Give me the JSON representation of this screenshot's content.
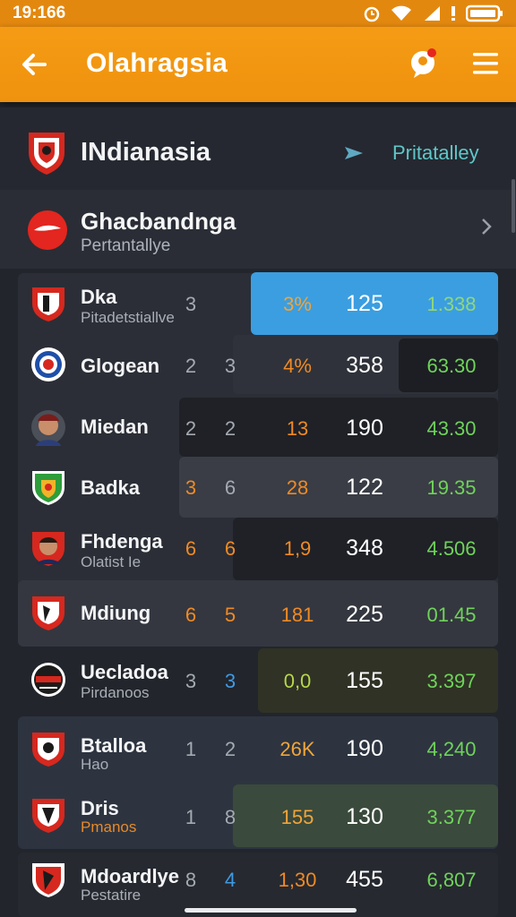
{
  "status_bar": {
    "time": "19:166"
  },
  "app_bar": {
    "title": "Olahragsia"
  },
  "league": {
    "name": "INdianasia",
    "link": "Pritatalley"
  },
  "team": {
    "name": "Ghacbandnga",
    "subtitle": "Pertantallye"
  },
  "colors": {
    "accent": "#f59b14",
    "highlight": "#3b9ee0",
    "value_green": "#6fd35a",
    "value_orange": "#f08a24"
  },
  "rows": [
    {
      "name": "Dka",
      "sub": "Pitadetstiallve",
      "c1": "3",
      "c2": "",
      "c3": "3%",
      "c4": "125",
      "c5": "1.338",
      "logo": "red-shield-icon"
    },
    {
      "name": "Glogean",
      "sub": "",
      "c1": "2",
      "c2": "3",
      "c3": "4%",
      "c4": "358",
      "c5": "63.30",
      "logo": "blue-ring-icon"
    },
    {
      "name": "Miedan",
      "sub": "",
      "c1": "2",
      "c2": "2",
      "c3": "13",
      "c4": "190",
      "c5": "43.30",
      "logo": "player-face-icon"
    },
    {
      "name": "Badka",
      "sub": "",
      "c1": "3",
      "c2": "6",
      "c3": "28",
      "c4": "122",
      "c5": "19.35",
      "logo": "green-shield-icon"
    },
    {
      "name": "Fhdenga",
      "sub": "Olatist Ie",
      "c1": "6",
      "c2": "6",
      "c3": "1,9",
      "c4": "348",
      "c5": "4.506",
      "logo": "player-face-icon"
    },
    {
      "name": "Mdiung",
      "sub": "",
      "c1": "6",
      "c2": "5",
      "c3": "181",
      "c4": "225",
      "c5": "01.45",
      "logo": "red-shield-icon"
    },
    {
      "name": "Uecladoa",
      "sub": "Pirdanoos",
      "c1": "3",
      "c2": "3",
      "c3": "0,0",
      "c4": "155",
      "c5": "3.397",
      "logo": "round-crest-icon"
    },
    {
      "name": "Btalloa",
      "sub": "Hao",
      "c1": "1",
      "c2": "2",
      "c3": "26K",
      "c4": "190",
      "c5": "4,240",
      "logo": "red-shield-icon"
    },
    {
      "name": "Dris",
      "sub": "Pmanos",
      "c1": "1",
      "c2": "8",
      "c3": "155",
      "c4": "130",
      "c5": "3.377",
      "logo": "red-shield-icon"
    },
    {
      "name": "Mdoardlye",
      "sub": "Pestatire",
      "c1": "8",
      "c2": "4",
      "c3": "1,30",
      "c4": "455",
      "c5": "6,807",
      "logo": "white-shield-icon"
    }
  ]
}
